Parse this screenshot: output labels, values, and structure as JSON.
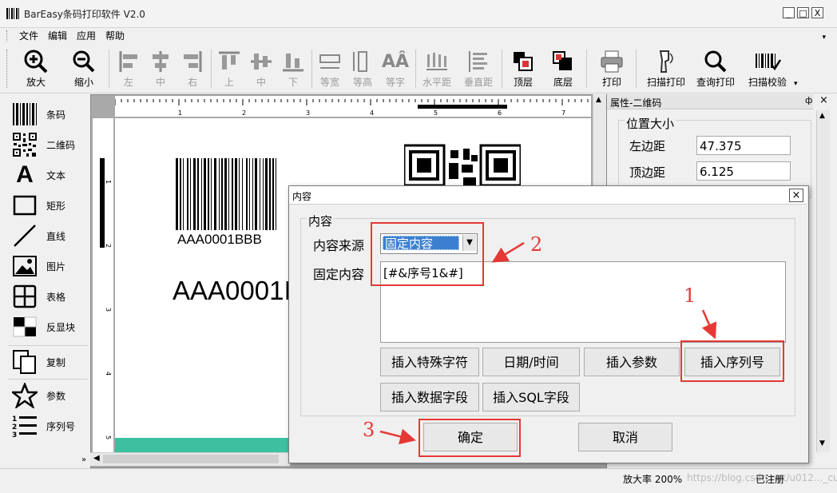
{
  "window": {
    "title": "BarEasy条码打印软件 V2.0",
    "min": "_",
    "max": "□",
    "close": "X"
  },
  "menu": [
    "文件",
    "编辑",
    "应用",
    "帮助"
  ],
  "toolbar": {
    "zoom_in": "放大",
    "zoom_out": "缩小",
    "align_left": "左",
    "align_center": "中",
    "align_right": "右",
    "align_top": "上",
    "align_middle": "中",
    "align_bottom": "下",
    "same_width": "等宽",
    "same_height": "等高",
    "same_font": "等字",
    "h_spacing": "水平距",
    "v_spacing": "垂直距",
    "top_layer": "顶层",
    "bottom_layer": "底层",
    "print": "打印",
    "scan_print": "扫描打印",
    "query_print": "查询打印",
    "scan_verify": "扫描校验"
  },
  "sidebar": {
    "items": [
      "条码",
      "二维码",
      "文本",
      "矩形",
      "直线",
      "图片",
      "表格",
      "反显块",
      "复制",
      "参数",
      "序列号"
    ]
  },
  "canvas": {
    "ruler_marks": [
      "1",
      "2",
      "3",
      "4",
      "5",
      "6",
      "7"
    ],
    "left_marks": [
      "1",
      "2",
      "3",
      "4",
      "5"
    ],
    "barcode_text": "AAA0001BBB",
    "big_text": "AAA0001I"
  },
  "properties": {
    "header": "属性-二维码",
    "group": "位置大小",
    "left_label": "左边距",
    "left_value": "47.375",
    "top_label": "顶边距",
    "top_value": "6.125"
  },
  "status": {
    "zoom": "放大率 200%",
    "registered": "已注册",
    "watermark": "https://blog.csdn.net/u012..._cu"
  },
  "dialog": {
    "title": "内容",
    "group": "内容",
    "source_label": "内容来源",
    "source_value": "固定内容",
    "fixed_label": "固定内容",
    "fixed_value": "[#&序号1&#]",
    "buttons": {
      "special_char": "插入特殊字符",
      "datetime": "日期/时间",
      "param": "插入参数",
      "serial": "插入序列号",
      "data_field": "插入数据字段",
      "sql_field": "插入SQL字段"
    },
    "ok": "确定",
    "cancel": "取消"
  },
  "annotations": {
    "n1": "1",
    "n2": "2",
    "n3": "3"
  },
  "colors": {
    "highlight_red": "#e53935",
    "select_blue": "#3c7fd0",
    "teal_bar": "#3cc0a0"
  }
}
